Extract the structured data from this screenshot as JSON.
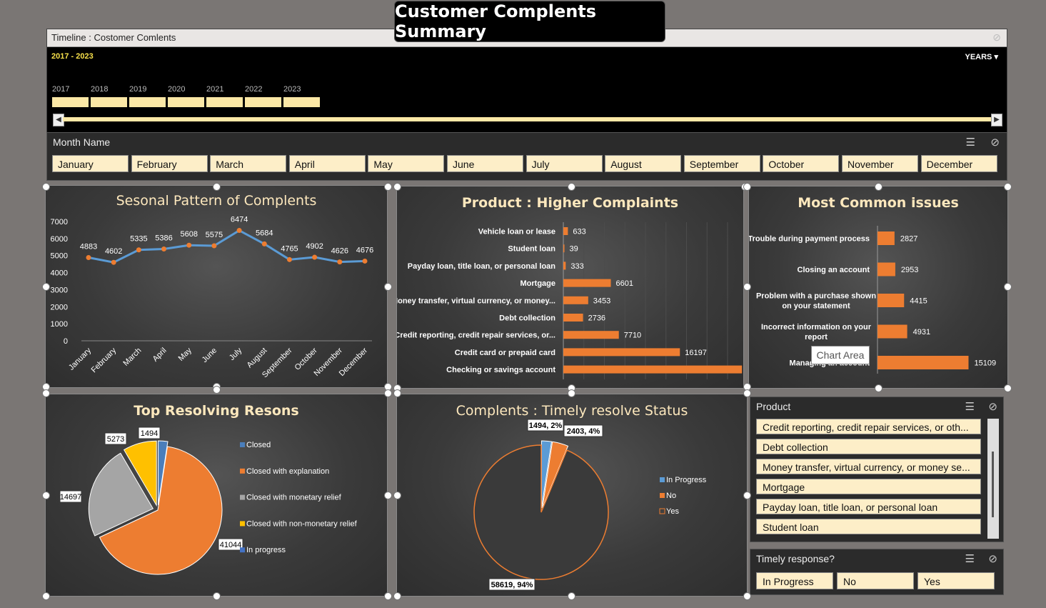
{
  "title": "Customer Complents Summary",
  "timeline": {
    "header": "Timeline : Costomer Comlents",
    "range_label": "2017 - 2023",
    "period_label": "YEARS",
    "years": [
      "2017",
      "2018",
      "2019",
      "2020",
      "2021",
      "2022",
      "2023"
    ]
  },
  "month_slicer": {
    "header": "Month Name",
    "months": [
      "January",
      "February",
      "March",
      "April",
      "May",
      "June",
      "July",
      "August",
      "September",
      "October",
      "November",
      "December"
    ]
  },
  "product_slicer": {
    "header": "Product",
    "items": [
      "Credit reporting, credit repair services, or oth...",
      "Debt collection",
      "Money transfer, virtual currency, or money se...",
      "Mortgage",
      "Payday loan, title loan, or personal loan",
      "Student loan"
    ]
  },
  "timely_slicer": {
    "header": "Timely response?",
    "items": [
      "In Progress",
      "No",
      "Yes"
    ]
  },
  "tooltip": "Chart Area",
  "colors": {
    "line": "#5b9bd5",
    "orange": "#ed7d31",
    "gray": "#a5a5a5",
    "yellow": "#ffc000",
    "blue": "#4472c4",
    "slicer_item": "#fdeec8",
    "title_text": "#fde8bd"
  },
  "chart_data": [
    {
      "type": "line",
      "title": "Sesonal Pattern of Complents",
      "categories": [
        "January",
        "February",
        "March",
        "April",
        "May",
        "June",
        "July",
        "August",
        "September",
        "October",
        "November",
        "December"
      ],
      "values": [
        4883,
        4602,
        5335,
        5386,
        5608,
        5575,
        6474,
        5684,
        4765,
        4902,
        4626,
        4676
      ],
      "ylim": [
        0,
        7000
      ],
      "yticks": [
        0,
        1000,
        2000,
        3000,
        4000,
        5000,
        6000,
        7000
      ]
    },
    {
      "type": "bar",
      "title": "Product : Higher Complaints",
      "categories": [
        "Vehicle loan or lease",
        "Student loan",
        "Payday loan, title loan, or personal loan",
        "Mortgage",
        "Money transfer, virtual currency, or money...",
        "Debt collection",
        "Credit reporting, credit repair services, or...",
        "Credit card or prepaid card",
        "Checking or savings account"
      ],
      "values": [
        633,
        39,
        333,
        6601,
        3453,
        2736,
        7710,
        16197,
        24814
      ],
      "xlim": [
        0,
        25000
      ]
    },
    {
      "type": "bar",
      "title": "Most Common issues",
      "categories": [
        [
          "Trouble during payment process"
        ],
        [
          "Closing an account"
        ],
        [
          "Problem with a purchase shown",
          "on your statement"
        ],
        [
          "Incorrect information on your",
          "report"
        ],
        [
          "Managing an account"
        ]
      ],
      "values": [
        2827,
        2953,
        4415,
        4931,
        15109
      ],
      "xlim": [
        0,
        16000
      ]
    },
    {
      "type": "pie",
      "title": "Top Resolving Resons",
      "labels": [
        "Closed",
        "Closed with explanation",
        "Closed with monetary relief",
        "Closed with non-monetary relief",
        "In progress"
      ],
      "values": [
        1494,
        41044,
        14697,
        5273,
        0
      ]
    },
    {
      "type": "pie",
      "title": "Complents : Timely resolve Status",
      "labels": [
        "In Progress",
        "No",
        "Yes"
      ],
      "values": [
        1494,
        2403,
        58619
      ],
      "data_labels": [
        "1494, 2%",
        "2403, 4%",
        "58619, 94%"
      ]
    }
  ]
}
